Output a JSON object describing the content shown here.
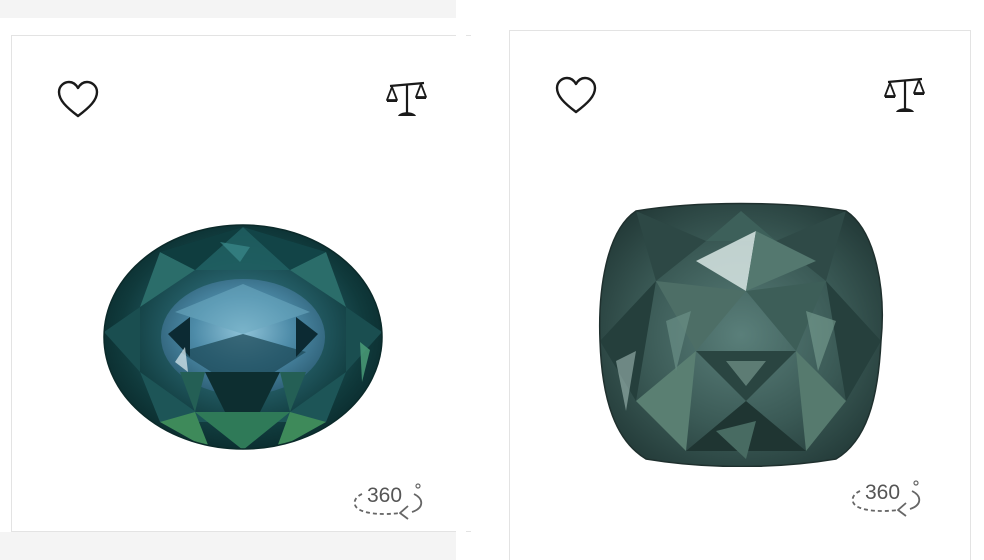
{
  "products": [
    {
      "favorite_icon": "heart-outline-icon",
      "compare_icon": "balance-scale-icon",
      "gem_shape": "oval",
      "view360_label": "360",
      "view360_icon": "rotate-360-icon"
    },
    {
      "favorite_icon": "heart-outline-icon",
      "compare_icon": "balance-scale-icon",
      "gem_shape": "cushion",
      "view360_label": "360",
      "view360_icon": "rotate-360-icon"
    }
  ],
  "colors": {
    "icon": "#1a1a1a",
    "card_border": "#e3e3e3",
    "strip_background": "#f4f4f4",
    "gem_1_primary": "#1e5a5e",
    "gem_2_primary": "#3f5e5a"
  }
}
